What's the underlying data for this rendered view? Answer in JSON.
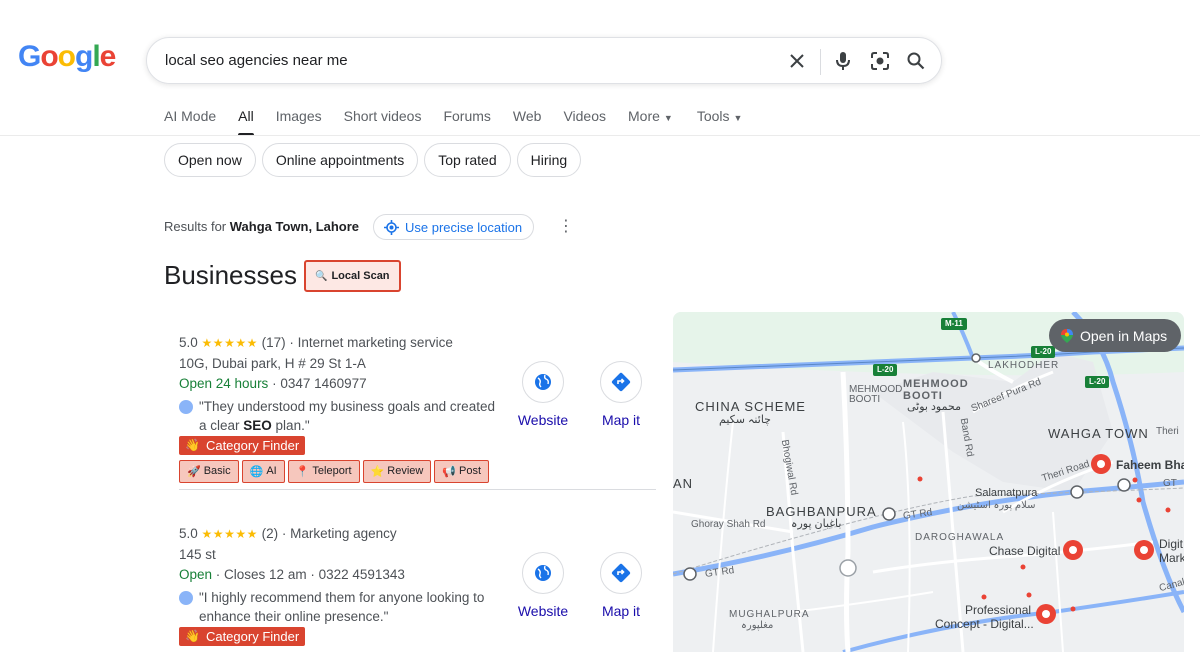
{
  "logo": {
    "text": "Google"
  },
  "search": {
    "query": "local seo agencies near me",
    "icons": [
      "close-icon",
      "mic-icon",
      "lens-icon",
      "search-icon"
    ]
  },
  "tabs": [
    {
      "label": "AI Mode"
    },
    {
      "label": "All",
      "active": true
    },
    {
      "label": "Images"
    },
    {
      "label": "Short videos"
    },
    {
      "label": "Forums"
    },
    {
      "label": "Web"
    },
    {
      "label": "Videos"
    },
    {
      "label": "More"
    },
    {
      "label": "Tools"
    }
  ],
  "chips": [
    "Open now",
    "Online appointments",
    "Top rated",
    "Hiring"
  ],
  "location": {
    "prefix": "Results for",
    "place": "Wahga Town, Lahore",
    "precise_label": "Use precise location"
  },
  "section": {
    "title": "Businesses",
    "local_scan": "Local Scan"
  },
  "listings": [
    {
      "rating": "5.0",
      "stars": "★★★★★",
      "reviews": "(17)",
      "category": "Internet marketing service",
      "address": "10G, Dubai park, H # 29 St 1-A",
      "hours": "Open 24 hours",
      "phone": "0347 1460977",
      "quote_pre": "\"They understood my business goals and created a clear ",
      "quote_bold": "SEO",
      "quote_post": " plan.\"",
      "category_finder": "Category Finder",
      "tools": [
        "Basic",
        "AI",
        "Teleport",
        "Review",
        "Post"
      ],
      "website_label": "Website",
      "map_label": "Map it"
    },
    {
      "rating": "5.0",
      "stars": "★★★★★",
      "reviews": "(2)",
      "category": "Marketing agency",
      "address": "145 st",
      "hours": "Open",
      "hours_rest": "Closes 12 am",
      "phone": "0322 4591343",
      "quote": "\"I highly recommend them for anyone looking to enhance their online presence.\"",
      "category_finder": "Category Finder",
      "website_label": "Website",
      "map_label": "Map it"
    }
  ],
  "map": {
    "open_label": "Open in Maps",
    "labels": {
      "china_scheme": "CHINA SCHEME",
      "china_scheme_ur": "چائنہ سکیم",
      "mehmood_booti_small": "MEHMOOD BOOTI",
      "mehmood_booti": "MEHMOOD BOOTI",
      "mehmood_booti_ur": "محمود بوٹی",
      "lakhodher": "LAKHODHER",
      "shareef_pura": "Shareef Pura Rd",
      "wahga_town": "WAHGA TOWN",
      "theri_top": "Theri",
      "bhogiwal": "Bhogiwal Rd",
      "band_rd": "Band Rd",
      "theri_road": "Theri Road",
      "salamatpura": "Salamatpura",
      "salamatpura_ur": "سلام پورہ اسٹیشن",
      "an": "AN",
      "ghoray_shah": "Ghoray Shah Rd",
      "baghbanpura": "BAGHBANPURA",
      "baghbanpura_ur": "باغبان پورہ",
      "gt_rd1": "GT Rd",
      "daroghawala": "DAROGHAWALA",
      "gt_rd2": "GT Rd",
      "mughalpura": "MUGHALPURA",
      "mughalpura_ur": "مغلپورہ",
      "canal": "Canal",
      "faheem": "Faheem Bha",
      "chase": "Chase Digital",
      "digit": "Digit",
      "mark": "Mark",
      "professional1": "Professional",
      "professional2": "Concept - Digital...",
      "gt_edge": "GT"
    },
    "shields": [
      "M-11",
      "L-20",
      "L-20",
      "L-20"
    ]
  },
  "colors": {
    "accent_red": "#d9442f",
    "link_blue": "#1a0dab",
    "open_green": "#188038",
    "star_yellow": "#fbbc04"
  }
}
